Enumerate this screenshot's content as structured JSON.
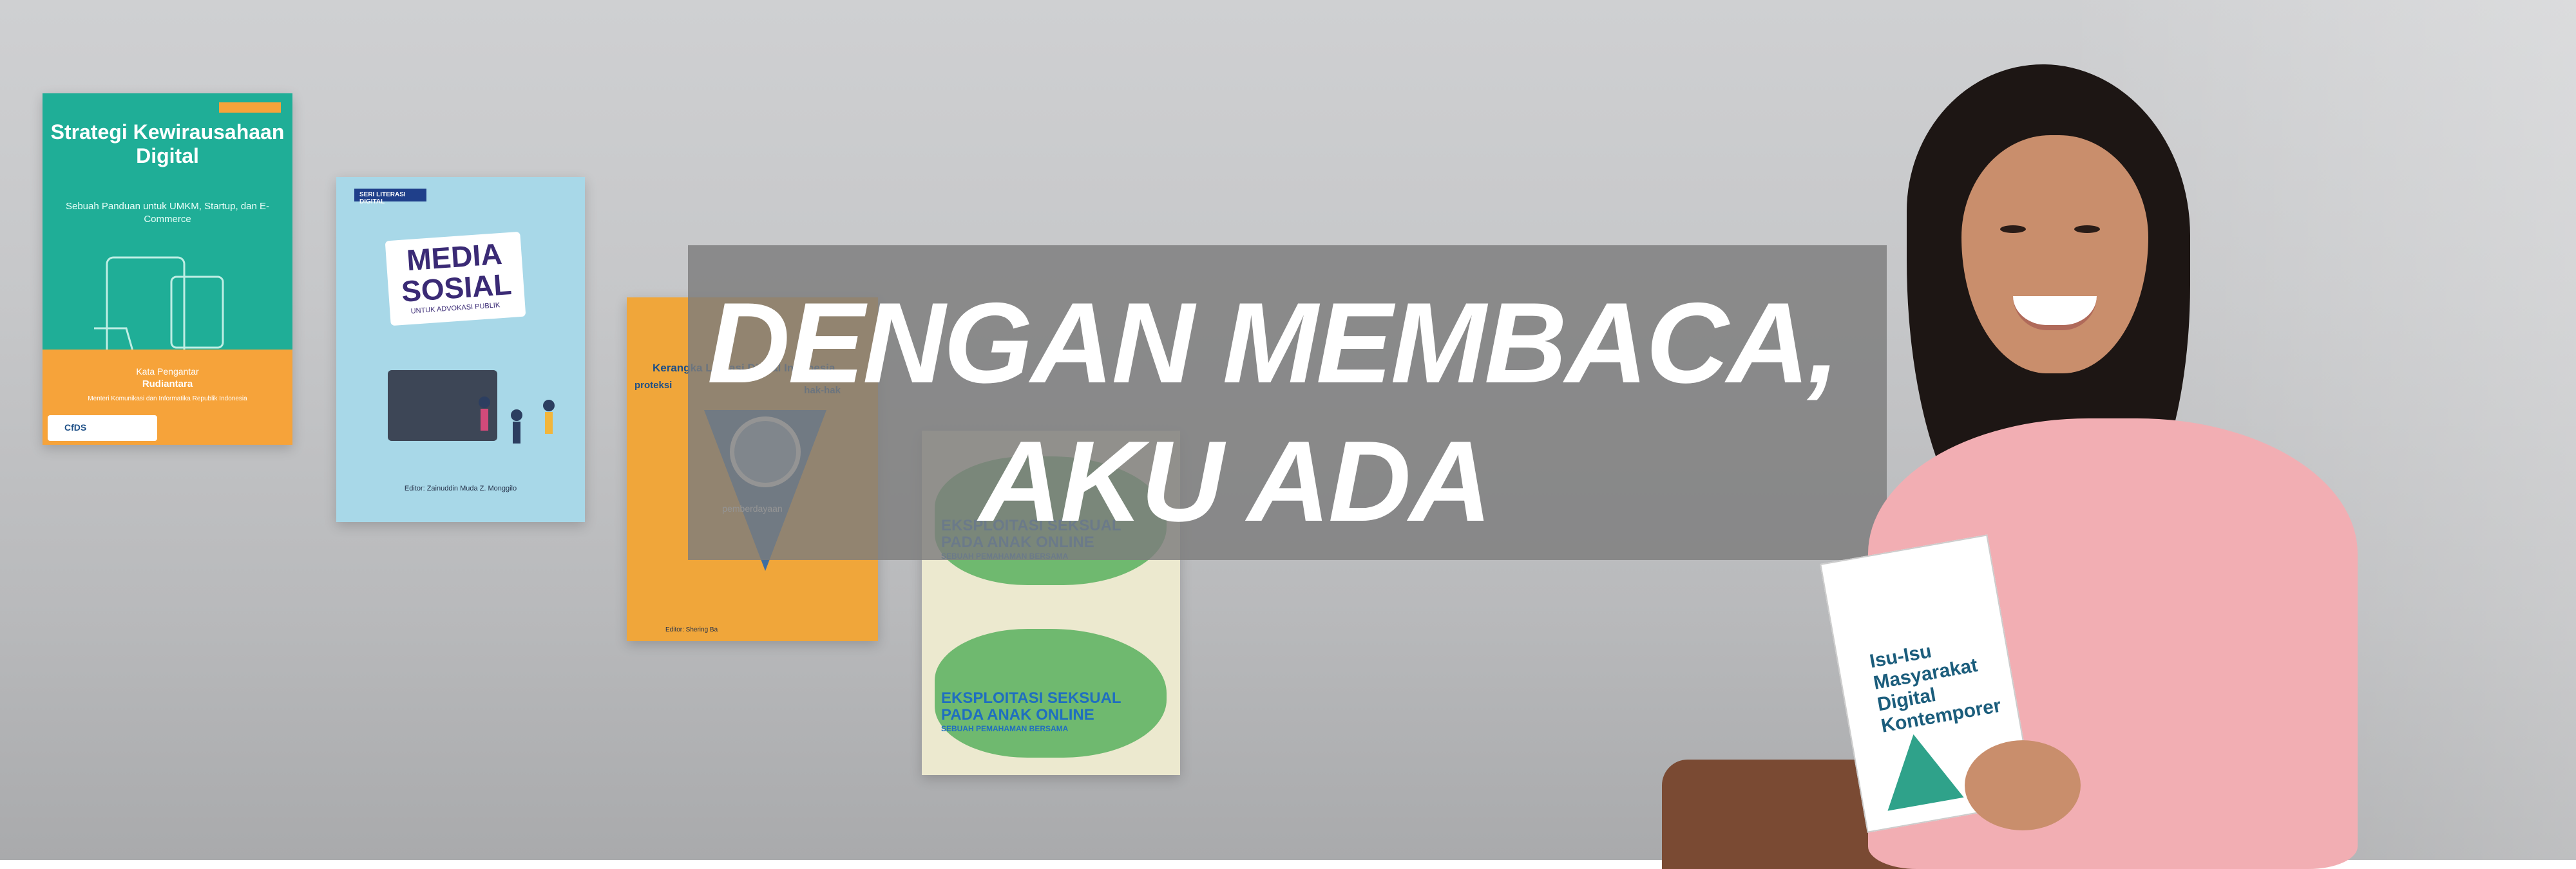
{
  "headline": {
    "line1": "DENGAN MEMBACA,",
    "line2": "AKU ADA"
  },
  "books": {
    "book1": {
      "title": "Strategi Kewirausahaan Digital",
      "subtitle": "Sebuah Panduan untuk UMKM, Startup, dan E-Commerce",
      "foreword_label": "Kata Pengantar",
      "foreword_name": "Rudiantara",
      "foreword_role": "Menteri Komunikasi dan Informatika Republik Indonesia",
      "logo": "CfDS"
    },
    "book2": {
      "series": "SERI LITERASI DIGITAL",
      "title": "MEDIA SOSIAL",
      "subtitle": "UNTUK ADVOKASI PUBLIK",
      "editor": "Editor: Zainuddin Muda Z. Monggilo"
    },
    "book3": {
      "header": "Kerangka Literasi Digital Indonesia",
      "left_label": "proteksi",
      "right_label": "hak-hak",
      "center_label": "pemberdayaan",
      "editor": "Editor: Shering Ba"
    },
    "book4": {
      "line1": "EKSPLOITASI SEKSUAL",
      "line2": "PADA ANAK ONLINE",
      "line3": "SEBUAH PEMAHAMAN BERSAMA"
    },
    "person_book": {
      "title": "Isu-Isu Masyarakat Digital Kontemporer"
    }
  },
  "colors": {
    "band": "#7d7d7d",
    "headline": "#ffffff",
    "book1_bg": "#1fae97",
    "book1_orange": "#f6a33a",
    "book2_bg": "#a8d8e8",
    "book3_bg": "#f0a63a",
    "book4_blue": "#1f6ec0"
  }
}
